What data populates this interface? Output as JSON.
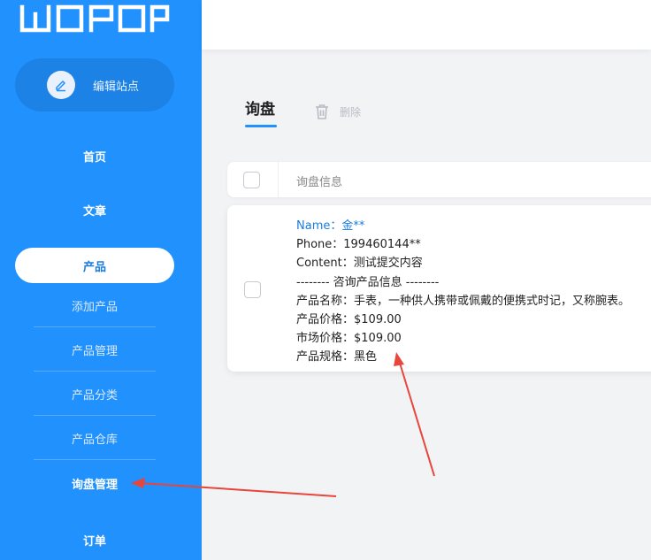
{
  "brand": {
    "logo_text": "WOPOP"
  },
  "sidebar": {
    "edit_site_label": "编辑站点",
    "nav": {
      "home": "首页",
      "articles": "文章",
      "products": "产品",
      "orders": "订单"
    },
    "product_sub": {
      "add": "添加产品",
      "manage": "产品管理",
      "category": "产品分类",
      "warehouse": "产品仓库",
      "inquiry": "询盘管理"
    }
  },
  "main": {
    "tab_title": "询盘",
    "delete_label": "删除",
    "table": {
      "header": "询盘信息",
      "rows": [
        {
          "name": "Name：金**",
          "phone": "Phone：199460144**",
          "content": "Content：测试提交内容",
          "divider": "-------- 咨询产品信息 --------",
          "product_name": "产品名称：手表，一种供人携带或佩戴的便携式时记，又称腕表。",
          "product_price": "产品价格：$109.00",
          "market_price": "市场价格：$109.00",
          "product_spec": "产品规格：黑色"
        }
      ]
    }
  },
  "colors": {
    "sidebar_bg": "#2091fd",
    "accent": "#1b7de0",
    "annotation": "#e8453c"
  },
  "icons": {
    "edit": "pencil-icon",
    "delete": "trash-icon"
  }
}
